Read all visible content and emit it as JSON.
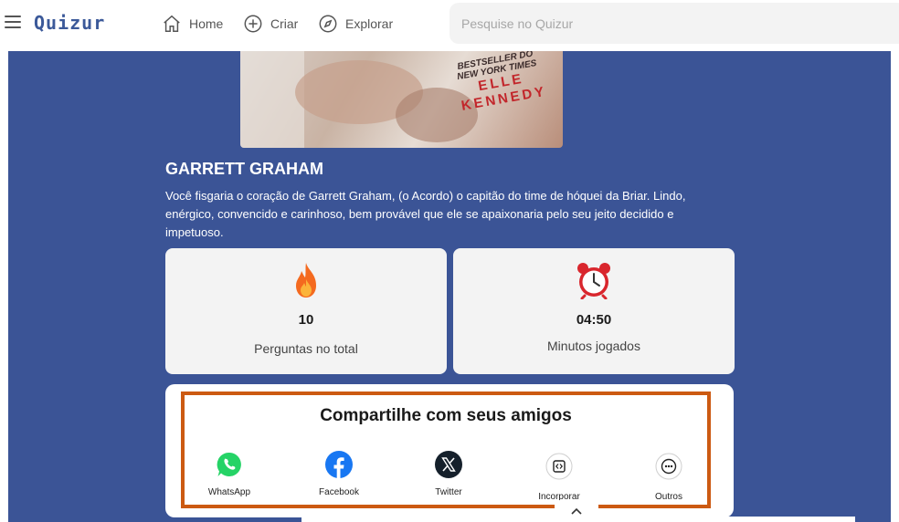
{
  "header": {
    "logo": "Quizur",
    "nav": [
      {
        "label": "Home",
        "icon": "home-icon"
      },
      {
        "label": "Criar",
        "icon": "plus-circle-icon"
      },
      {
        "label": "Explorar",
        "icon": "compass-icon"
      }
    ],
    "search": {
      "placeholder": "Pesquise no Quizur",
      "value": ""
    }
  },
  "cover": {
    "tagline": "BESTSELLER DO NEW YORK TIMES",
    "author_first": "ELLE",
    "author_last": "KENNEDY"
  },
  "result": {
    "title": "GARRETT GRAHAM",
    "description": "Você fisgaria o coração de Garrett Graham, (o Acordo) o capitão do time de hóquei da Briar. Lindo, enérgico, convencido e carinhoso, bem provável que ele se apaixonaria pelo seu jeito decidido e impetuoso."
  },
  "stats": [
    {
      "icon": "fire-icon",
      "value": "10",
      "label": "Perguntas no total"
    },
    {
      "icon": "alarm-clock-icon",
      "value": "04:50",
      "label": "Minutos jogados"
    }
  ],
  "share": {
    "title": "Compartilhe com seus amigos",
    "buttons": [
      {
        "label": "WhatsApp",
        "icon": "whatsapp-icon"
      },
      {
        "label": "Facebook",
        "icon": "facebook-icon"
      },
      {
        "label": "Twitter",
        "icon": "x-twitter-icon"
      },
      {
        "label": "Incorporar",
        "icon": "embed-code-icon"
      },
      {
        "label": "Outros",
        "icon": "more-icon"
      }
    ]
  },
  "colors": {
    "panel": "#3b5496",
    "highlight_border": "#cc5a12",
    "logo": "#3b5999"
  }
}
